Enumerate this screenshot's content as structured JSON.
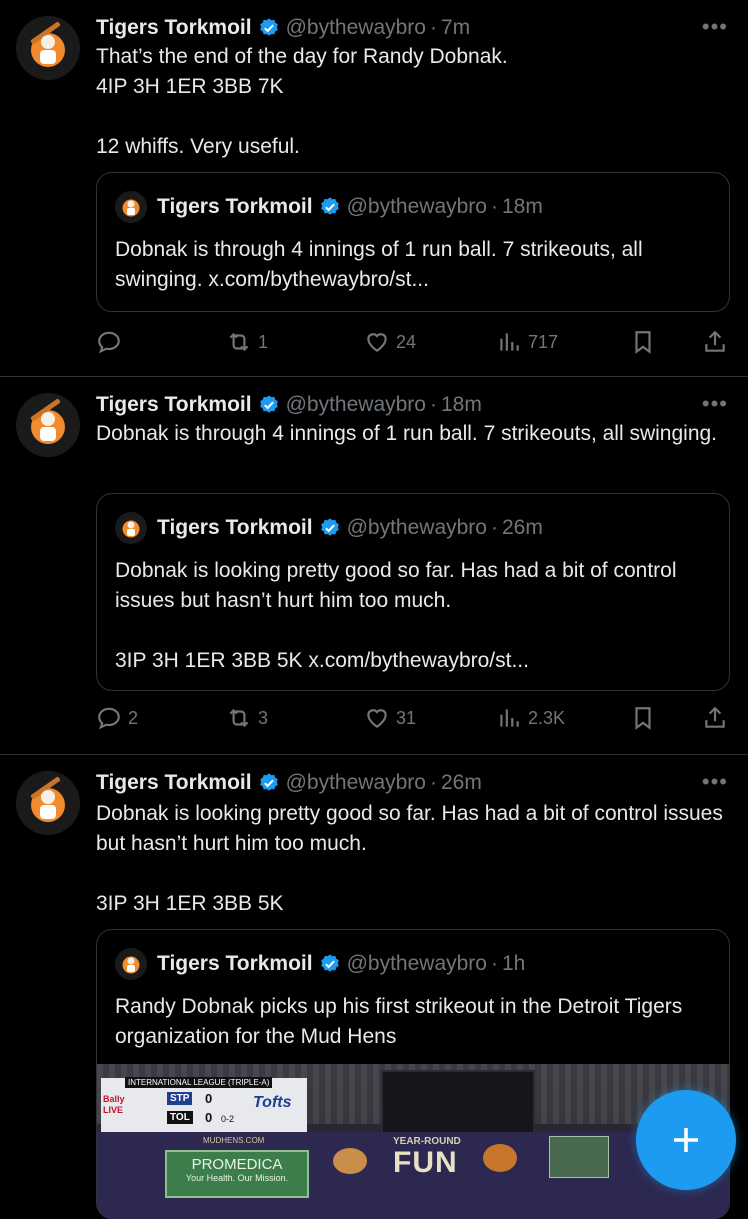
{
  "tweets": [
    {
      "name": "Tigers Torkmoil",
      "handle": "@bythewaybro",
      "time": "7m",
      "text": "That’s the end of the day for Randy Dobnak.\n4IP 3H 1ER 3BB 7K\n\n12 whiffs. Very useful.",
      "quote": {
        "name": "Tigers Torkmoil",
        "handle": "@bythewaybro",
        "time": "18m",
        "text": "Dobnak is through 4 innings of 1 run ball. 7 strikeouts, all swinging. x.com/bythewaybro/st..."
      },
      "actions": {
        "replies": "",
        "reposts": "1",
        "likes": "24",
        "views": "717"
      }
    },
    {
      "name": "Tigers Torkmoil",
      "handle": "@bythewaybro",
      "time": "18m",
      "text": "Dobnak is through 4 innings of 1 run ball. 7 strikeouts, all swinging.",
      "quote": {
        "name": "Tigers Torkmoil",
        "handle": "@bythewaybro",
        "time": "26m",
        "text": "Dobnak is looking pretty good so far. Has had a bit of control issues but hasn’t hurt him too much.\n\n3IP 3H 1ER 3BB 5K x.com/bythewaybro/st..."
      },
      "actions": {
        "replies": "2",
        "reposts": "3",
        "likes": "31",
        "views": "2.3K"
      }
    },
    {
      "name": "Tigers Torkmoil",
      "handle": "@bythewaybro",
      "time": "26m",
      "text": "Dobnak is looking pretty good so far. Has had a bit of control issues but hasn’t hurt him too much.\n\n3IP 3H 1ER 3BB 5K",
      "quote": {
        "name": "Tigers Torkmoil",
        "handle": "@bythewaybro",
        "time": "1h",
        "text": "Randy Dobnak picks up his first strikeout in the Detroit Tigers organization for the Mud Hens"
      }
    }
  ],
  "separator": "·",
  "more_glyph": "•••",
  "video": {
    "league": "INTERNATIONAL LEAGUE (TRIPLE-A)",
    "team1": "STP",
    "score1": "0",
    "team2": "TOL",
    "score2": "0",
    "count": "0-2",
    "network": "Bally LIVE",
    "sponsor": "Tofts",
    "site": "MUDHENS.COM",
    "banner1": "YEAR-ROUND",
    "banner2": "FUN",
    "ad1": "PROMEDICA",
    "ad2": "Your Health. Our Mission."
  },
  "fab_icon": "plus-icon",
  "colors": {
    "background": "#000000",
    "text": "#e7e9ea",
    "muted": "#71767b",
    "accent": "#1d9bf0",
    "border": "#2f3336"
  }
}
